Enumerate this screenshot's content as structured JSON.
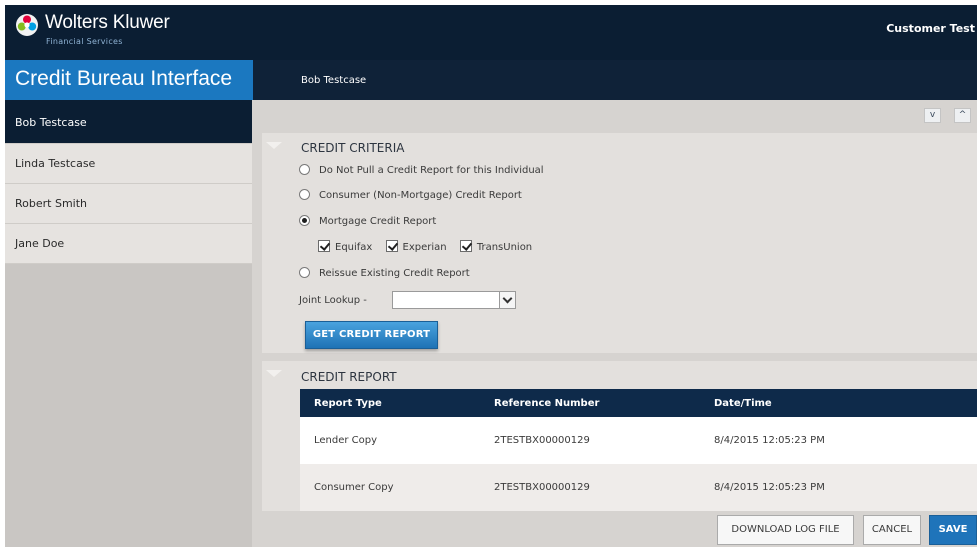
{
  "header": {
    "brand": "Wolters Kluwer",
    "brand_sub": "Financial Services",
    "user": "Customer Test"
  },
  "appbar": {
    "title": "Credit Bureau Interface",
    "crumb": "Bob Testcase"
  },
  "sidebar": {
    "items": [
      {
        "label": "Bob Testcase",
        "active": true
      },
      {
        "label": "Linda Testcase",
        "active": false
      },
      {
        "label": "Robert Smith",
        "active": false
      },
      {
        "label": "Jane Doe",
        "active": false
      }
    ]
  },
  "criteria": {
    "heading": "CREDIT CRITERIA",
    "options": [
      {
        "label": "Do Not Pull a Credit Report for this Individual",
        "selected": false
      },
      {
        "label": "Consumer (Non-Mortgage) Credit Report",
        "selected": false
      },
      {
        "label": "Mortgage Credit Report",
        "selected": true
      },
      {
        "label": "Reissue Existing Credit Report",
        "selected": false
      }
    ],
    "bureaus": [
      {
        "label": "Equifax",
        "checked": true
      },
      {
        "label": "Experian",
        "checked": true
      },
      {
        "label": "TransUnion",
        "checked": true
      }
    ],
    "joint_label": "Joint Lookup -",
    "joint_value": "",
    "get_button": "GET CREDIT REPORT"
  },
  "report": {
    "heading": "CREDIT REPORT",
    "columns": [
      "Report Type",
      "Reference Number",
      "Date/Time"
    ],
    "rows": [
      [
        "Lender Copy",
        "2TESTBX00000129",
        "8/4/2015 12:05:23 PM"
      ],
      [
        "Consumer Copy",
        "2TESTBX00000129",
        "8/4/2015 12:05:23 PM"
      ]
    ]
  },
  "footer": {
    "download": "DOWNLOAD LOG FILE",
    "cancel": "CANCEL",
    "save": "SAVE"
  },
  "controls": {
    "collapse": "v",
    "expand": "^"
  },
  "colors": {
    "header_bg": "#0b1e33",
    "accent_blue": "#1b78c0",
    "table_head": "#0e2a4a"
  }
}
